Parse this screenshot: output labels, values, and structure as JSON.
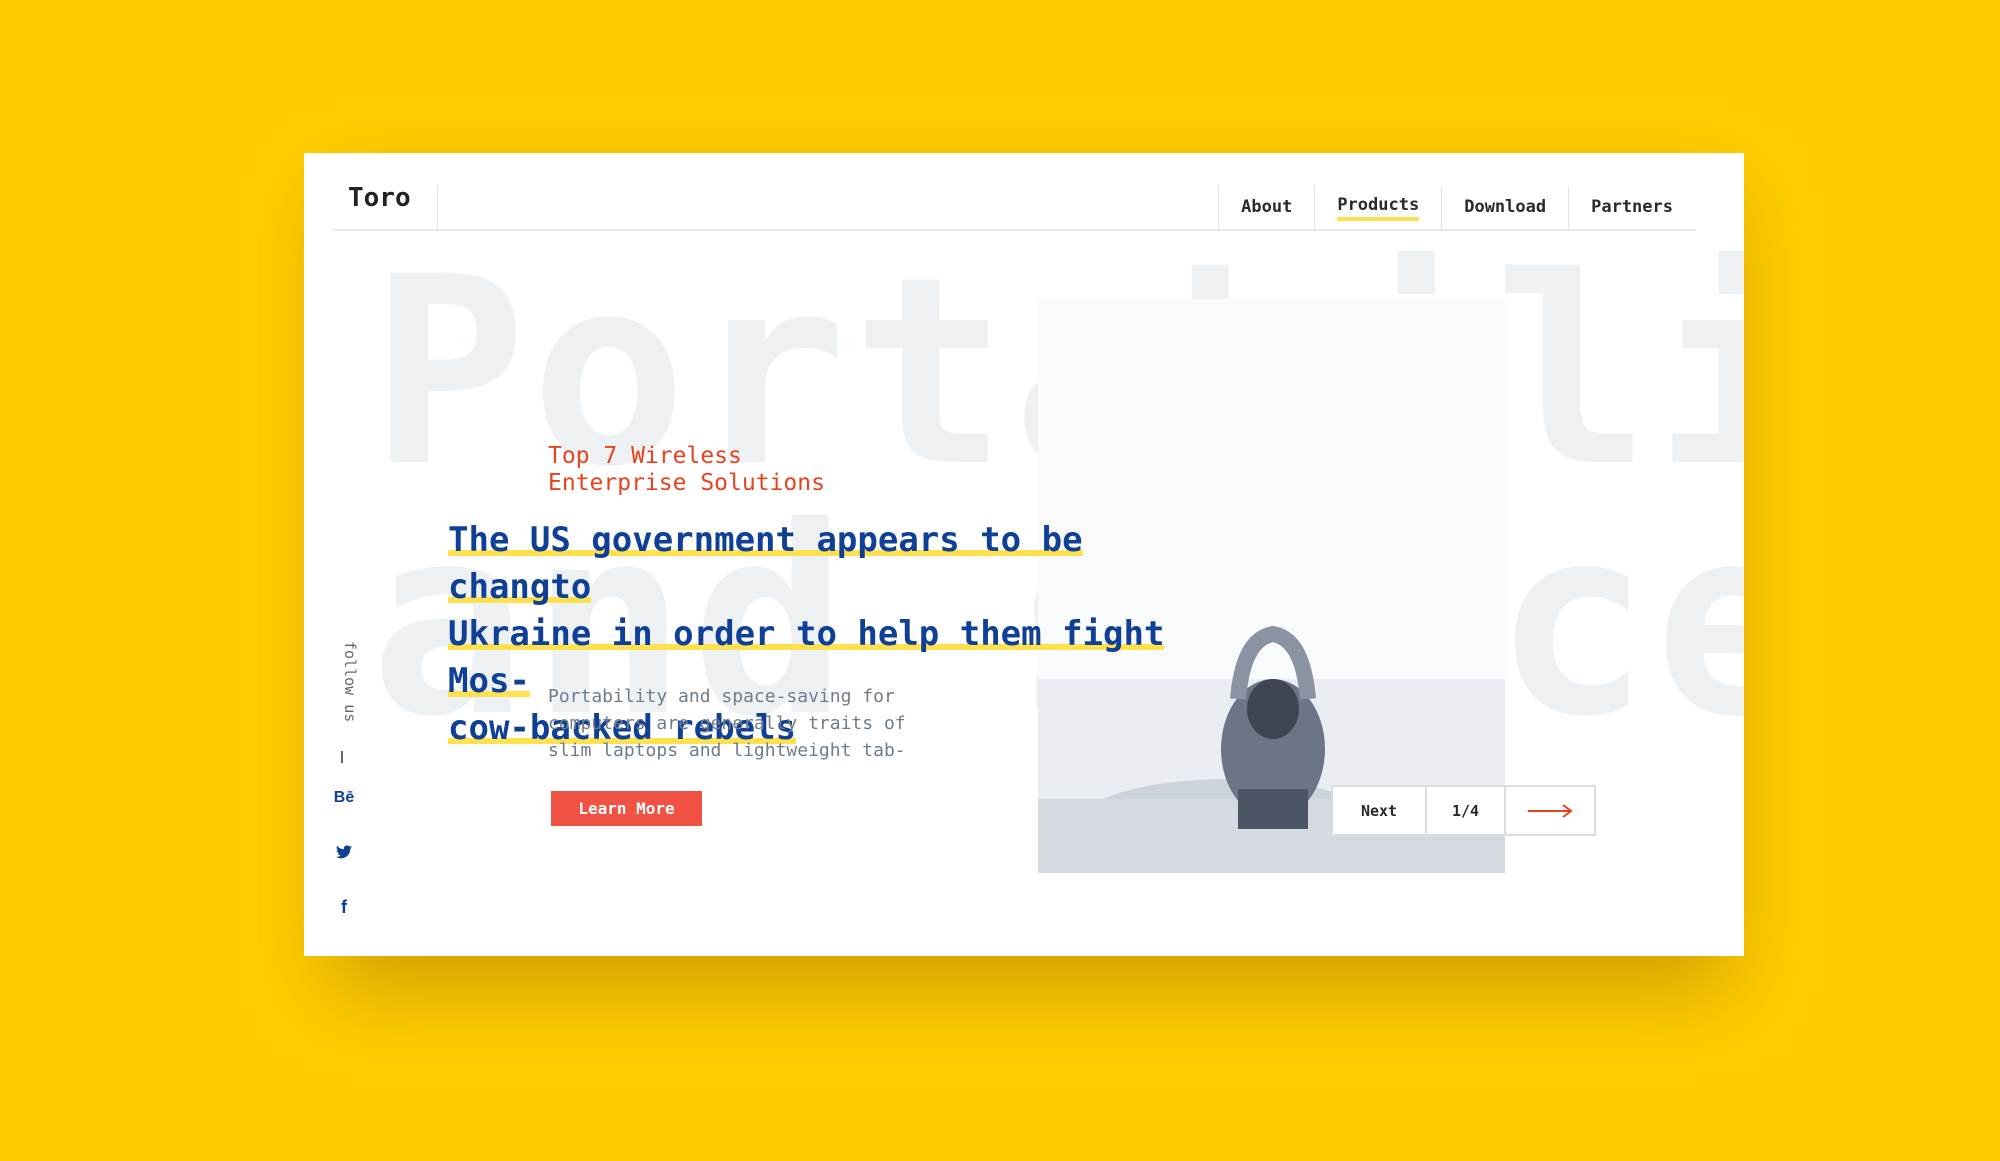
{
  "brand": "Toro",
  "nav": {
    "items": [
      {
        "label": "About"
      },
      {
        "label": "Products"
      },
      {
        "label": "Download"
      },
      {
        "label": "Partners"
      }
    ],
    "active": "Products"
  },
  "hero": {
    "background_word_line1": "Portability",
    "background_word_line2": "and space",
    "kicker_line1": "Top 7 Wireless",
    "kicker_line2": "Enterprise Solutions",
    "headline_line1": "The US government appears to be changto",
    "headline_line2": "Ukraine in order to help them fight Mos-",
    "headline_line3": "cow-backed rebels",
    "description_line1": "Portability and space-saving for",
    "description_line2": "computers are generally traits of",
    "description_line3": "slim laptops and lightweight tab-",
    "cta_label": "Learn More"
  },
  "slider": {
    "next_label": "Next",
    "counter": "1/4"
  },
  "social": {
    "follow_label": "follow us",
    "behance": "Bē",
    "twitter": "twitter",
    "facebook": "f"
  },
  "colors": {
    "background": "#FFCC00",
    "accent_red": "#E8431E",
    "headline_blue": "#0F4096",
    "highlight_yellow": "#FFE14D"
  }
}
